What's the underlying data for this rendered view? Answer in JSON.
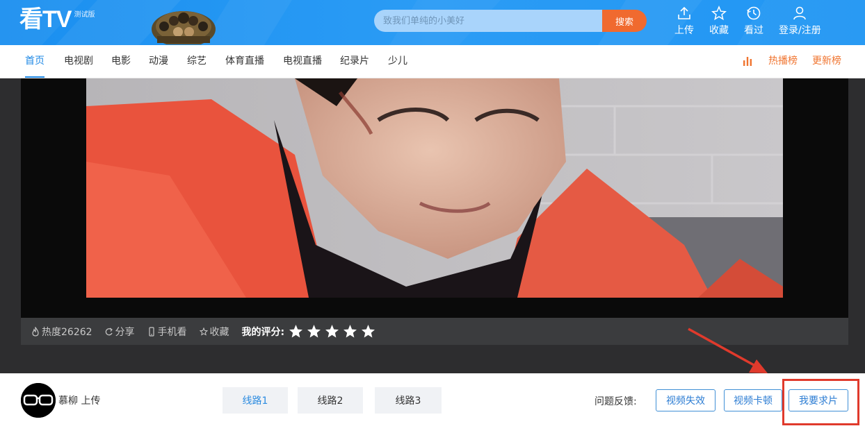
{
  "header": {
    "logo": "看TV",
    "beta": "测试版",
    "search_placeholder": "致我们单纯的小美好",
    "search_button": "搜索",
    "actions": [
      {
        "label": "上传",
        "icon": "upload-icon"
      },
      {
        "label": "收藏",
        "icon": "star-icon"
      },
      {
        "label": "看过",
        "icon": "history-icon"
      },
      {
        "label": "登录/注册",
        "icon": "user-icon"
      }
    ]
  },
  "nav": {
    "items": [
      "首页",
      "电视剧",
      "电影",
      "动漫",
      "综艺",
      "体育直播",
      "电视直播",
      "纪录片",
      "少儿"
    ],
    "active": "首页",
    "right": [
      "热播榜",
      "更新榜"
    ]
  },
  "player": {
    "heat": "热度26262",
    "share": "分享",
    "mobile": "手机看",
    "favorite": "收藏",
    "rating_label": "我的评分:",
    "stars": 5
  },
  "bottom": {
    "uploader_name": "慕柳",
    "uploader_suffix": "上传",
    "lines": [
      "线路1",
      "线路2",
      "线路3"
    ],
    "active_line": "线路1",
    "feedback_label": "问题反馈:",
    "feedback_buttons": [
      "视频失效",
      "视频卡顿",
      "我要求片"
    ]
  },
  "colors": {
    "brand_blue": "#1e88e5",
    "accent_orange": "#f06a2f",
    "highlight_red": "#e03a2c"
  }
}
